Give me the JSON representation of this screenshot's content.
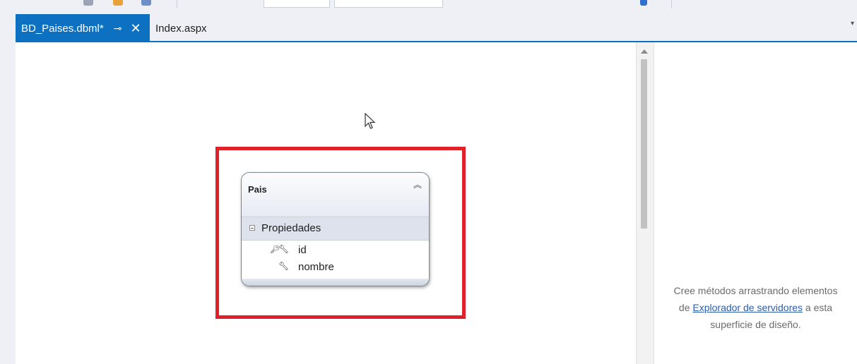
{
  "tabs": {
    "active": {
      "label": "BD_Paises.dbml*",
      "pin_icon": "pin-icon",
      "close_icon": "close-icon"
    },
    "inactive": {
      "label": "Index.aspx"
    },
    "dropdown_icon": "chevron-down-icon"
  },
  "diagram": {
    "entity": {
      "name": "Pais",
      "section": "Propiedades",
      "properties": [
        {
          "name": "id",
          "primary_key": true
        },
        {
          "name": "nombre",
          "primary_key": false
        }
      ]
    },
    "highlight_color": "#e0212a"
  },
  "methods_pane": {
    "hint_before": "Cree métodos arrastrando elementos",
    "hint_de": "de",
    "hint_link": "Explorador de servidores",
    "hint_after": "a esta",
    "hint_end": "superficie de diseño."
  },
  "colors": {
    "accent": "#0e70c0",
    "link": "#2a5db0"
  }
}
